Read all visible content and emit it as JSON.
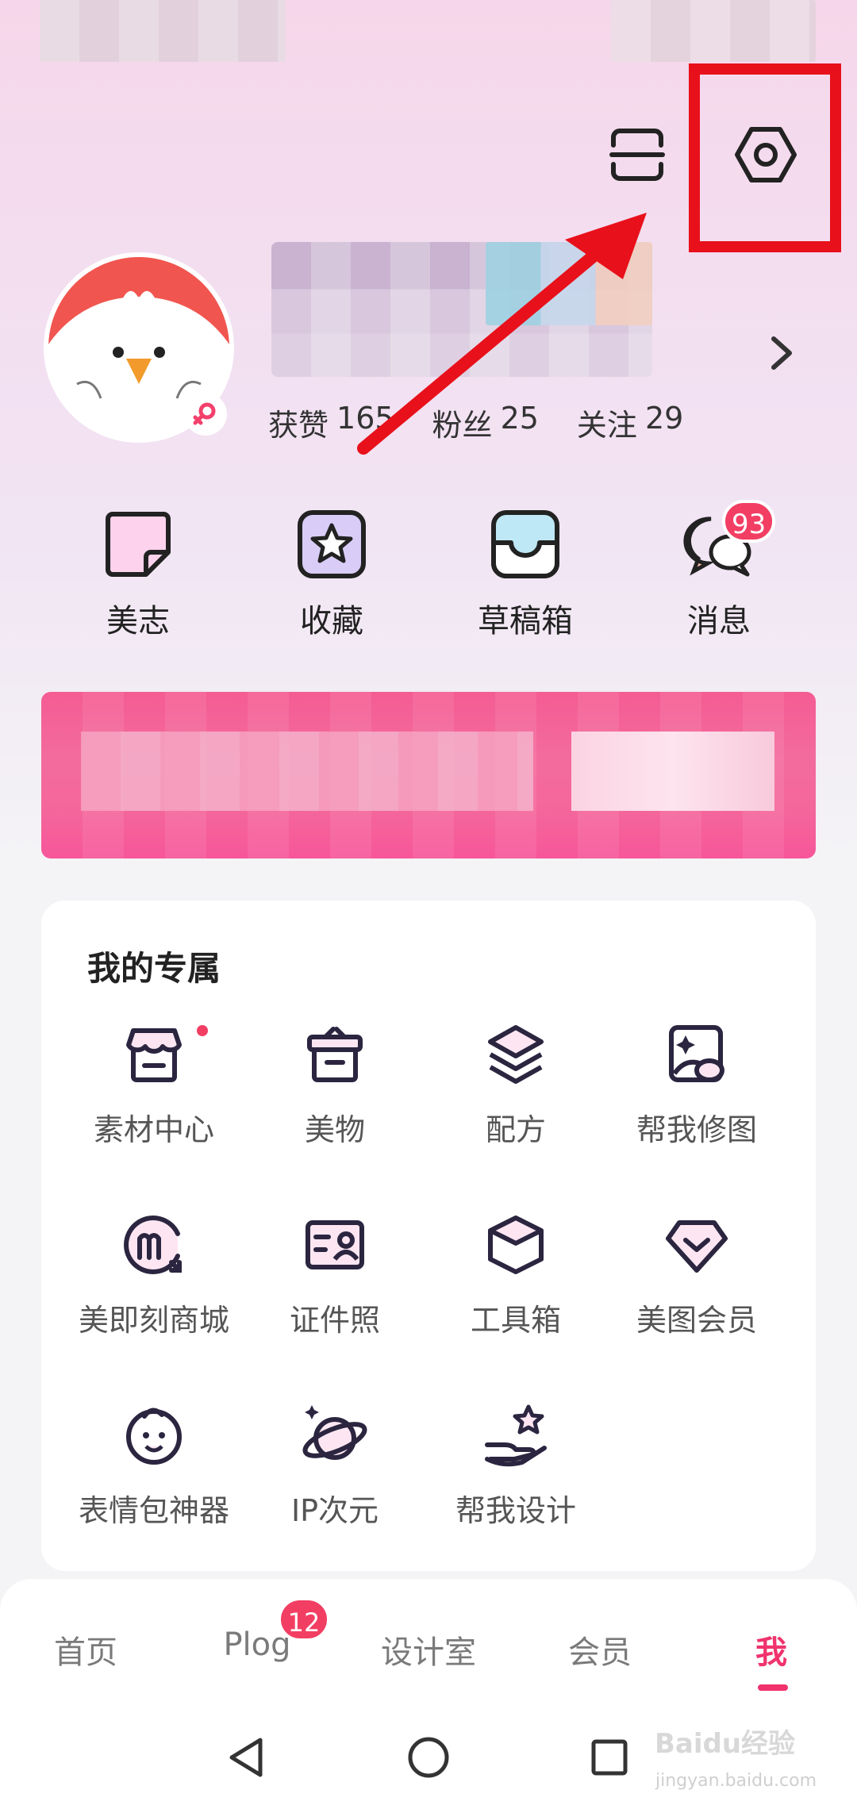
{
  "header": {
    "scan_icon": "scan-icon",
    "settings_icon": "settings-icon"
  },
  "profile": {
    "stats": [
      {
        "label": "获赞",
        "value": "165"
      },
      {
        "label": "粉丝",
        "value": "25"
      },
      {
        "label": "关注",
        "value": "29"
      }
    ]
  },
  "quick_actions": [
    {
      "label": "美志",
      "icon": "journal-icon"
    },
    {
      "label": "收藏",
      "icon": "star-icon"
    },
    {
      "label": "草稿箱",
      "icon": "drafts-icon"
    },
    {
      "label": "消息",
      "icon": "message-icon",
      "badge": "93"
    }
  ],
  "exclusive": {
    "title": "我的专属",
    "items": [
      {
        "label": "素材中心",
        "icon": "store-icon"
      },
      {
        "label": "美物",
        "icon": "gift-box-icon"
      },
      {
        "label": "配方",
        "icon": "layers-icon"
      },
      {
        "label": "帮我修图",
        "icon": "photo-edit-icon"
      },
      {
        "label": "美即刻商城",
        "icon": "mall-icon"
      },
      {
        "label": "证件照",
        "icon": "id-card-icon"
      },
      {
        "label": "工具箱",
        "icon": "toolbox-icon"
      },
      {
        "label": "美图会员",
        "icon": "diamond-icon"
      },
      {
        "label": "表情包神器",
        "icon": "baby-face-icon"
      },
      {
        "label": "IP次元",
        "icon": "planet-icon"
      },
      {
        "label": "帮我设计",
        "icon": "hand-star-icon"
      }
    ]
  },
  "tabbar": {
    "tabs": [
      {
        "label": "首页"
      },
      {
        "label": "Plog",
        "badge": "12"
      },
      {
        "label": "设计室"
      },
      {
        "label": "会员"
      },
      {
        "label": "我",
        "active": true
      }
    ]
  },
  "watermark": {
    "text": "Baidu经验",
    "sub": "jingyan.baidu.com"
  },
  "colors": {
    "accent": "#f0336d",
    "badge": "#f23e63",
    "highlight": "#e8101a"
  }
}
